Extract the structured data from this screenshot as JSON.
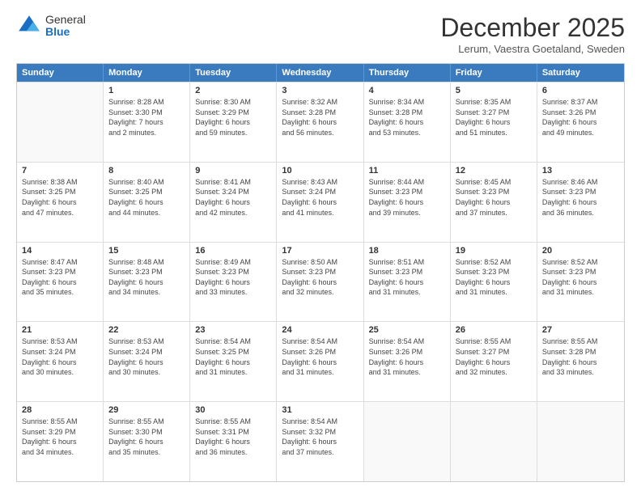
{
  "header": {
    "logo_general": "General",
    "logo_blue": "Blue",
    "month_title": "December 2025",
    "location": "Lerum, Vaestra Goetaland, Sweden"
  },
  "days_of_week": [
    "Sunday",
    "Monday",
    "Tuesday",
    "Wednesday",
    "Thursday",
    "Friday",
    "Saturday"
  ],
  "weeks": [
    [
      {
        "day": "",
        "info": ""
      },
      {
        "day": "1",
        "info": "Sunrise: 8:28 AM\nSunset: 3:30 PM\nDaylight: 7 hours\nand 2 minutes."
      },
      {
        "day": "2",
        "info": "Sunrise: 8:30 AM\nSunset: 3:29 PM\nDaylight: 6 hours\nand 59 minutes."
      },
      {
        "day": "3",
        "info": "Sunrise: 8:32 AM\nSunset: 3:28 PM\nDaylight: 6 hours\nand 56 minutes."
      },
      {
        "day": "4",
        "info": "Sunrise: 8:34 AM\nSunset: 3:28 PM\nDaylight: 6 hours\nand 53 minutes."
      },
      {
        "day": "5",
        "info": "Sunrise: 8:35 AM\nSunset: 3:27 PM\nDaylight: 6 hours\nand 51 minutes."
      },
      {
        "day": "6",
        "info": "Sunrise: 8:37 AM\nSunset: 3:26 PM\nDaylight: 6 hours\nand 49 minutes."
      }
    ],
    [
      {
        "day": "7",
        "info": "Sunrise: 8:38 AM\nSunset: 3:25 PM\nDaylight: 6 hours\nand 47 minutes."
      },
      {
        "day": "8",
        "info": "Sunrise: 8:40 AM\nSunset: 3:25 PM\nDaylight: 6 hours\nand 44 minutes."
      },
      {
        "day": "9",
        "info": "Sunrise: 8:41 AM\nSunset: 3:24 PM\nDaylight: 6 hours\nand 42 minutes."
      },
      {
        "day": "10",
        "info": "Sunrise: 8:43 AM\nSunset: 3:24 PM\nDaylight: 6 hours\nand 41 minutes."
      },
      {
        "day": "11",
        "info": "Sunrise: 8:44 AM\nSunset: 3:23 PM\nDaylight: 6 hours\nand 39 minutes."
      },
      {
        "day": "12",
        "info": "Sunrise: 8:45 AM\nSunset: 3:23 PM\nDaylight: 6 hours\nand 37 minutes."
      },
      {
        "day": "13",
        "info": "Sunrise: 8:46 AM\nSunset: 3:23 PM\nDaylight: 6 hours\nand 36 minutes."
      }
    ],
    [
      {
        "day": "14",
        "info": "Sunrise: 8:47 AM\nSunset: 3:23 PM\nDaylight: 6 hours\nand 35 minutes."
      },
      {
        "day": "15",
        "info": "Sunrise: 8:48 AM\nSunset: 3:23 PM\nDaylight: 6 hours\nand 34 minutes."
      },
      {
        "day": "16",
        "info": "Sunrise: 8:49 AM\nSunset: 3:23 PM\nDaylight: 6 hours\nand 33 minutes."
      },
      {
        "day": "17",
        "info": "Sunrise: 8:50 AM\nSunset: 3:23 PM\nDaylight: 6 hours\nand 32 minutes."
      },
      {
        "day": "18",
        "info": "Sunrise: 8:51 AM\nSunset: 3:23 PM\nDaylight: 6 hours\nand 31 minutes."
      },
      {
        "day": "19",
        "info": "Sunrise: 8:52 AM\nSunset: 3:23 PM\nDaylight: 6 hours\nand 31 minutes."
      },
      {
        "day": "20",
        "info": "Sunrise: 8:52 AM\nSunset: 3:23 PM\nDaylight: 6 hours\nand 31 minutes."
      }
    ],
    [
      {
        "day": "21",
        "info": "Sunrise: 8:53 AM\nSunset: 3:24 PM\nDaylight: 6 hours\nand 30 minutes."
      },
      {
        "day": "22",
        "info": "Sunrise: 8:53 AM\nSunset: 3:24 PM\nDaylight: 6 hours\nand 30 minutes."
      },
      {
        "day": "23",
        "info": "Sunrise: 8:54 AM\nSunset: 3:25 PM\nDaylight: 6 hours\nand 31 minutes."
      },
      {
        "day": "24",
        "info": "Sunrise: 8:54 AM\nSunset: 3:26 PM\nDaylight: 6 hours\nand 31 minutes."
      },
      {
        "day": "25",
        "info": "Sunrise: 8:54 AM\nSunset: 3:26 PM\nDaylight: 6 hours\nand 31 minutes."
      },
      {
        "day": "26",
        "info": "Sunrise: 8:55 AM\nSunset: 3:27 PM\nDaylight: 6 hours\nand 32 minutes."
      },
      {
        "day": "27",
        "info": "Sunrise: 8:55 AM\nSunset: 3:28 PM\nDaylight: 6 hours\nand 33 minutes."
      }
    ],
    [
      {
        "day": "28",
        "info": "Sunrise: 8:55 AM\nSunset: 3:29 PM\nDaylight: 6 hours\nand 34 minutes."
      },
      {
        "day": "29",
        "info": "Sunrise: 8:55 AM\nSunset: 3:30 PM\nDaylight: 6 hours\nand 35 minutes."
      },
      {
        "day": "30",
        "info": "Sunrise: 8:55 AM\nSunset: 3:31 PM\nDaylight: 6 hours\nand 36 minutes."
      },
      {
        "day": "31",
        "info": "Sunrise: 8:54 AM\nSunset: 3:32 PM\nDaylight: 6 hours\nand 37 minutes."
      },
      {
        "day": "",
        "info": ""
      },
      {
        "day": "",
        "info": ""
      },
      {
        "day": "",
        "info": ""
      }
    ]
  ]
}
